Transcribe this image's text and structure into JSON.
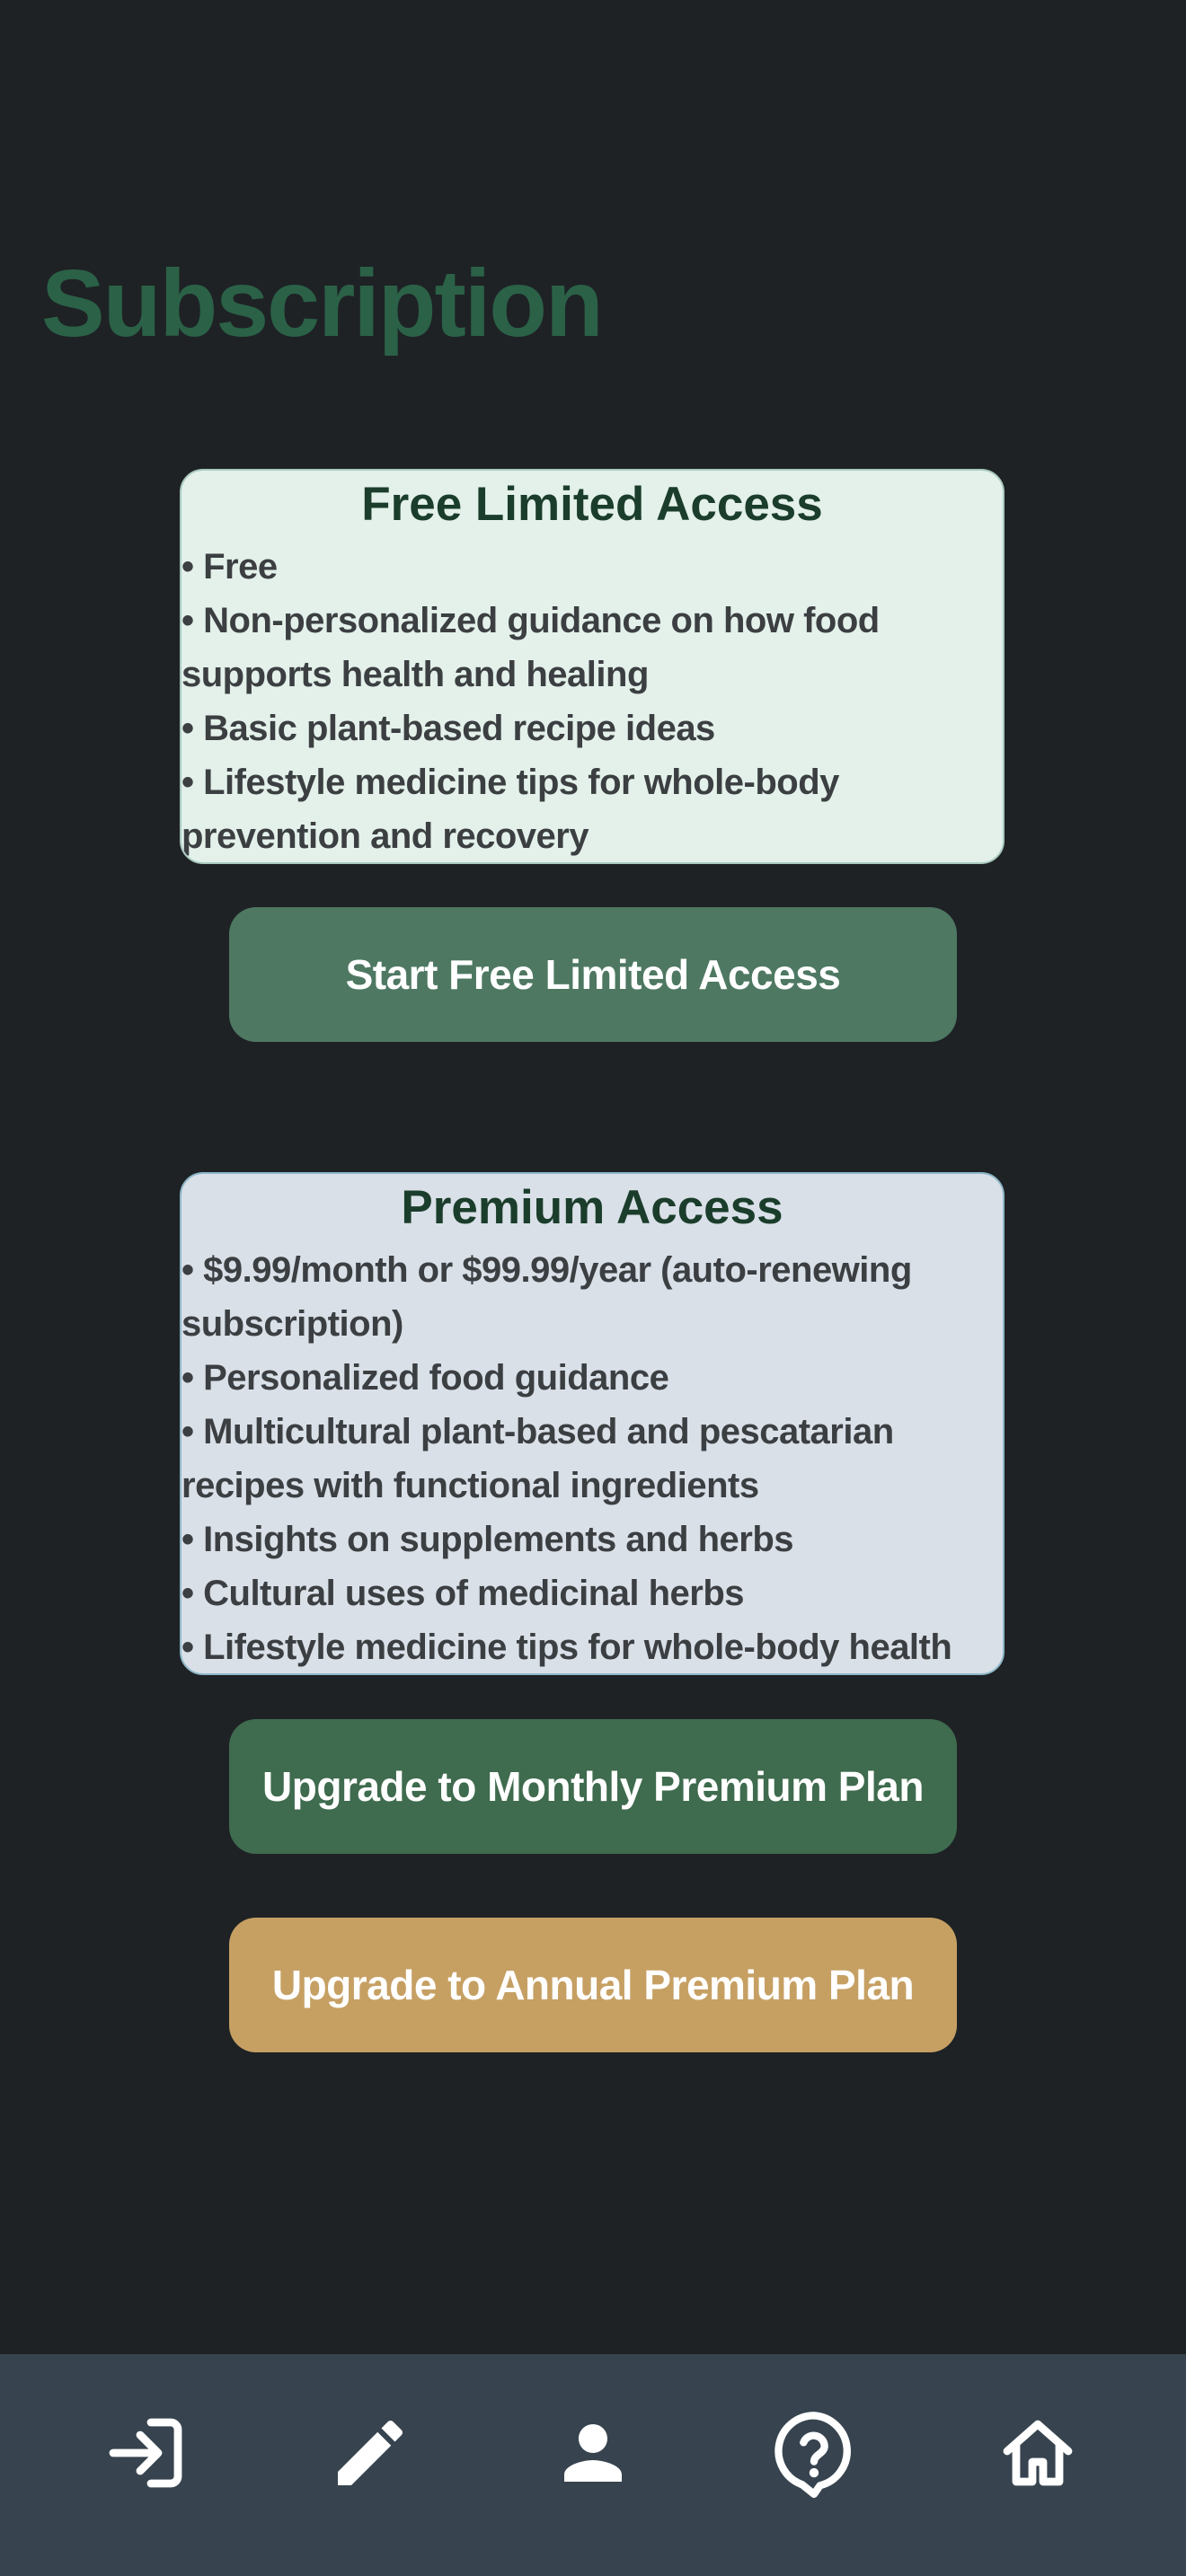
{
  "page": {
    "title": "Subscription"
  },
  "free_plan": {
    "title": "Free Limited Access",
    "features": [
      "• Free",
      "• Non-personalized guidance on how food supports health and healing",
      "• Basic plant-based recipe ideas",
      "• Lifestyle medicine tips for whole-body prevention and recovery"
    ],
    "button_label": "Start Free Limited Access"
  },
  "premium_plan": {
    "title": "Premium Access",
    "features": [
      "• $9.99/month or $99.99/year (auto-renewing subscription)",
      "• Personalized food guidance",
      "• Multicultural plant-based and pescatarian recipes with functional ingredients",
      "• Insights on supplements and herbs",
      "• Cultural uses of medicinal herbs",
      "• Lifestyle medicine tips for whole-body health"
    ],
    "monthly_button_label": "Upgrade to Monthly Premium Plan",
    "annual_button_label": "Upgrade to Annual Premium Plan"
  },
  "bottom_nav": {
    "items": [
      {
        "icon": "login-icon"
      },
      {
        "icon": "pencil-icon"
      },
      {
        "icon": "person-icon"
      },
      {
        "icon": "help-icon"
      },
      {
        "icon": "home-icon"
      }
    ]
  },
  "colors": {
    "background": "#1e2225",
    "title": "#2b6147",
    "free_card_bg": "#e3f1ea",
    "premium_card_bg": "#d9e0e8",
    "free_button": "#4e7862",
    "monthly_button": "#3f6b4e",
    "annual_button": "#c6a063",
    "nav_bar": "#37444f"
  }
}
